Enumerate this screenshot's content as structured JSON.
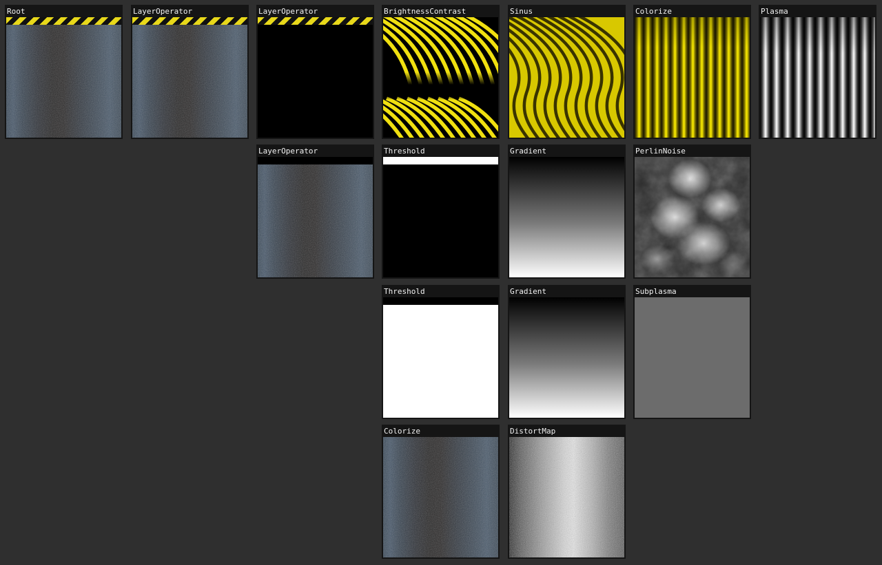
{
  "graph": {
    "nodes": [
      {
        "id": "root",
        "label": "Root",
        "texture": "metal-striped"
      },
      {
        "id": "layer-operator-1",
        "label": "LayerOperator",
        "texture": "metal-striped"
      },
      {
        "id": "layer-operator-2",
        "label": "LayerOperator",
        "texture": "black-striped"
      },
      {
        "id": "brightness-contrast",
        "label": "BrightnessContrast",
        "texture": "yellow-waves-contrast"
      },
      {
        "id": "sinus",
        "label": "Sinus",
        "texture": "yellow-waves"
      },
      {
        "id": "colorize-1",
        "label": "Colorize",
        "texture": "yellow-stripes"
      },
      {
        "id": "plasma",
        "label": "Plasma",
        "texture": "grey-stripes"
      },
      {
        "id": "layer-operator-3",
        "label": "LayerOperator",
        "texture": "metal-dark-bar"
      },
      {
        "id": "threshold-1",
        "label": "Threshold",
        "texture": "black-white-bar"
      },
      {
        "id": "gradient-1",
        "label": "Gradient",
        "texture": "vertical-gradient"
      },
      {
        "id": "perlin-noise",
        "label": "PerlinNoise",
        "texture": "clouds"
      },
      {
        "id": "threshold-2",
        "label": "Threshold",
        "texture": "white-dark-bar"
      },
      {
        "id": "gradient-2",
        "label": "Gradient",
        "texture": "vertical-gradient"
      },
      {
        "id": "subplasma",
        "label": "Subplasma",
        "texture": "noise"
      },
      {
        "id": "colorize-2",
        "label": "Colorize",
        "texture": "metal"
      },
      {
        "id": "distort-map",
        "label": "DistortMap",
        "texture": "grey-noise"
      }
    ]
  },
  "colors": {
    "background": "#2f2f2f",
    "node_frame": "#151515",
    "title_text": "#f2f2f2",
    "hazard_yellow": "#e8d81a",
    "hazard_black": "#111111"
  }
}
